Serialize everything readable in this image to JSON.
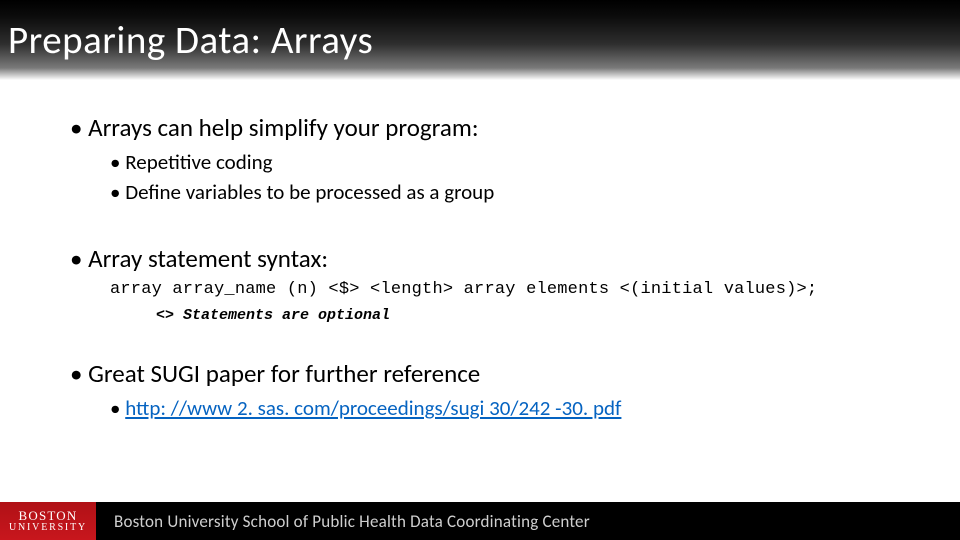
{
  "title": "Preparing Data: Arrays",
  "bullets": {
    "b1a": "Arrays can help simplify your program:",
    "b2a": "Repetitive coding",
    "b2b": "Define variables to be processed as a group",
    "b1b": "Array statement syntax:",
    "code": "array array_name (n) <$> <length> array elements <(initial values)>;",
    "note": "<> Statements are optional",
    "b1c": "Great SUGI paper for further reference",
    "link": "http: //www 2. sas. com/proceedings/sugi 30/242 -30. pdf"
  },
  "footer": {
    "logo_line1": "BOSTON",
    "logo_line2": "UNIVERSITY",
    "text": "Boston University School of Public Health Data Coordinating Center"
  }
}
